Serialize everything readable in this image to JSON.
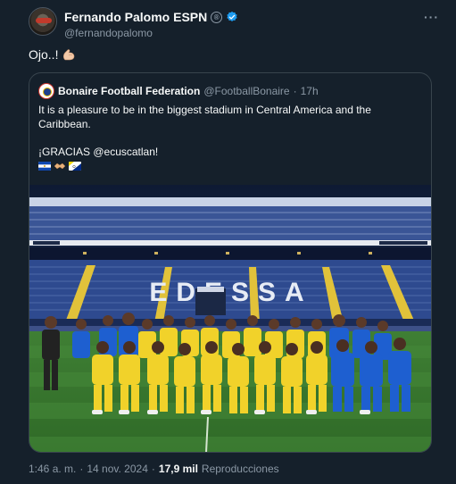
{
  "author": {
    "display_name": "Fernando Palomo ESPN",
    "registered_badge": "®",
    "handle": "@fernandopalomo"
  },
  "tweet": {
    "text": "Ojo..!"
  },
  "quoted": {
    "display_name": "Bonaire Football Federation",
    "handle": "@FootballBonaire",
    "separator": "·",
    "time": "17h",
    "text_line1": "It is a pleasure to be in the biggest stadium in Central America and the Caribbean.",
    "text_line2": "¡GRACIAS @ecuscatlan!",
    "image": {
      "stadium_sign": "EDESSA",
      "ad_small": "WILLIAMS",
      "ad_small_2": "SHERWIN-WILLIAMS"
    }
  },
  "footer": {
    "time": "1:46 a. m.",
    "sep": "·",
    "date": "14 nov. 2024",
    "sep2": "·",
    "views": "17,9 mil",
    "views_label": "Reproducciones"
  },
  "colors": {
    "background": "#15202b",
    "text": "#f7f9f9",
    "secondary": "#8b98a5",
    "border": "#38444d",
    "verified": "#1d9bf0"
  },
  "icons": [
    "verified-badge-icon",
    "more-options-icon",
    "flexed-biceps-emoji",
    "el-salvador-flag",
    "handshake-emoji",
    "bonaire-flag"
  ]
}
